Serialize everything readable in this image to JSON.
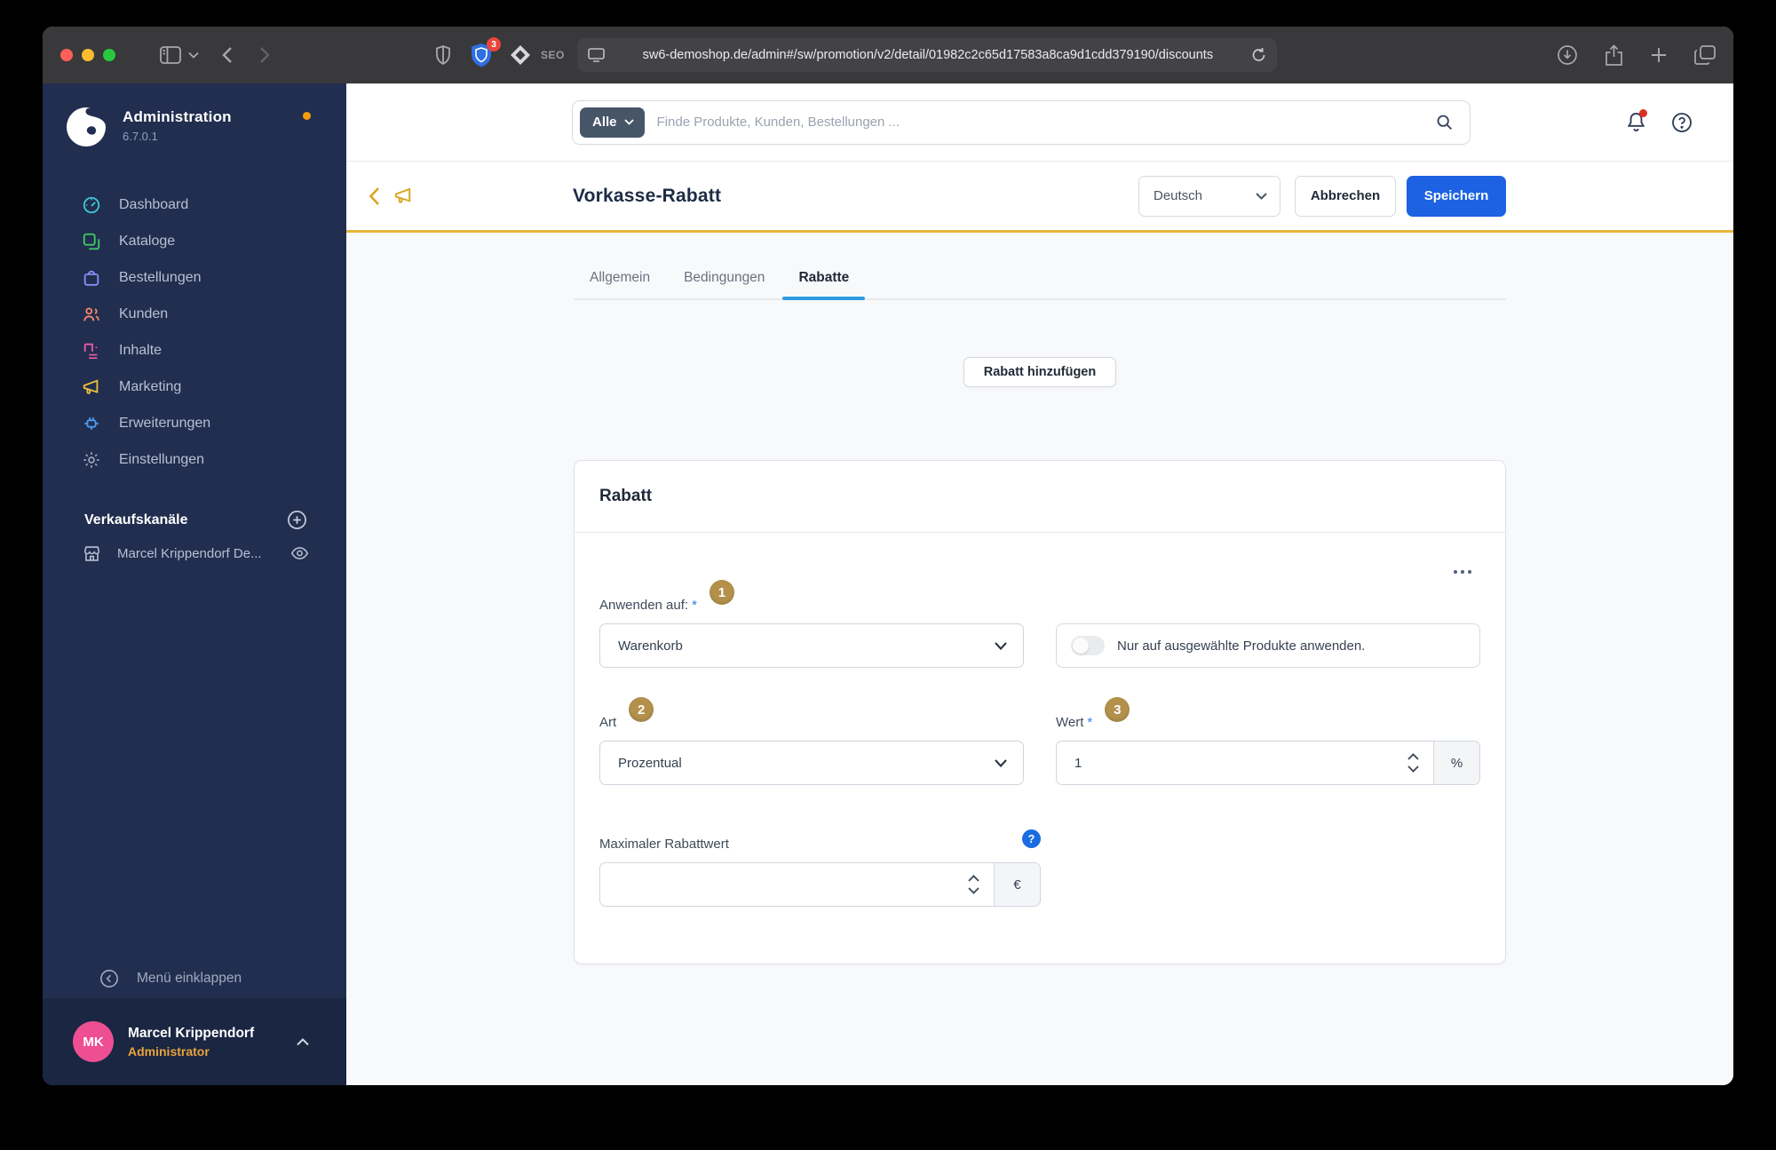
{
  "browser": {
    "url": "sw6-demoshop.de/admin#/sw/promotion/v2/detail/01982c2c65d17583a8ca9d1cdd379190/discounts",
    "seo_label": "SEO",
    "extension_badge": "3"
  },
  "sidebar": {
    "app_title": "Administration",
    "app_version": "6.7.0.1",
    "items": [
      {
        "label": "Dashboard",
        "icon": "dashboard-gauge-icon",
        "color": "#3fc6d5"
      },
      {
        "label": "Kataloge",
        "icon": "catalogues-icon",
        "color": "#3ecb62"
      },
      {
        "label": "Bestellungen",
        "icon": "orders-bag-icon",
        "color": "#8b8df7"
      },
      {
        "label": "Kunden",
        "icon": "customers-icon",
        "color": "#f5886a"
      },
      {
        "label": "Inhalte",
        "icon": "content-icon",
        "color": "#ec5ba4"
      },
      {
        "label": "Marketing",
        "icon": "marketing-megaphone-icon",
        "color": "#e9c03c"
      },
      {
        "label": "Erweiterungen",
        "icon": "extensions-plug-icon",
        "color": "#4d9bef"
      },
      {
        "label": "Einstellungen",
        "icon": "settings-gear-icon",
        "color": "#94a0b4"
      }
    ],
    "sales_channels_heading": "Verkaufskanäle",
    "sales_channel_name": "Marcel Krippendorf De...",
    "collapse_label": "Menü einklappen",
    "user_name": "Marcel Krippendorf",
    "user_role": "Administrator",
    "user_initials": "MK"
  },
  "header": {
    "search_scope": "Alle",
    "search_placeholder": "Finde Produkte, Kunden, Bestellungen ..."
  },
  "smartbar": {
    "title": "Vorkasse-Rabatt",
    "language": "Deutsch",
    "cancel_label": "Abbrechen",
    "save_label": "Speichern"
  },
  "tabs": [
    {
      "label": "Allgemein",
      "active": false
    },
    {
      "label": "Bedingungen",
      "active": false
    },
    {
      "label": "Rabatte",
      "active": true
    }
  ],
  "main": {
    "add_discount_label": "Rabatt hinzufügen",
    "card_title": "Rabatt",
    "fields": {
      "apply_to": {
        "label": "Anwenden auf:",
        "required_mark": "*",
        "badge": "1",
        "value": "Warenkorb"
      },
      "product_toggle": {
        "label": "Nur auf ausgewählte Produkte anwenden.",
        "state": "off"
      },
      "type": {
        "label": "Art",
        "badge": "2",
        "value": "Prozentual"
      },
      "value": {
        "label": "Wert",
        "required_mark": "*",
        "badge": "3",
        "value": "1",
        "unit": "%"
      },
      "max_value": {
        "label": "Maximaler Rabattwert",
        "help": "?",
        "value": "",
        "unit": "€"
      }
    }
  },
  "colors": {
    "accent_gold": "#e8b63f",
    "icon_gold": "#d9a520",
    "badge_gold": "#b3914b",
    "save_blue": "#1c62e3",
    "tab_indicator": "#2c9be0",
    "sidebar_navy": "#212e4f",
    "sidebar_footer_navy": "#1a2642",
    "avatar_pink": "#ee4f92",
    "role_orange": "#e8a33d",
    "required_blue": "#2a7fe8",
    "help_blue": "#1a6ce0",
    "notification_red": "#de2e21"
  }
}
